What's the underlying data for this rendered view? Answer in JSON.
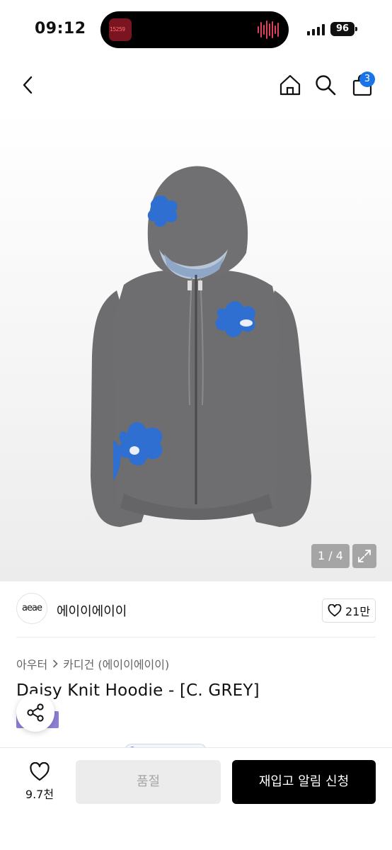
{
  "status": {
    "time": "09:12",
    "battery": "96",
    "island_thumb_text": "15259"
  },
  "nav": {
    "cart_count": "3"
  },
  "gallery": {
    "pager": "1 / 4"
  },
  "brand": {
    "logo_text": "aeae",
    "name": "에이이에이이",
    "likes": "21만"
  },
  "breadcrumb": {
    "category": "아우터",
    "subcategory": "카디건 (에이이에이이)"
  },
  "product": {
    "title": "Daisy Knit Hoodie - [C. GREY]"
  },
  "bottom": {
    "wish_count": "9.7천",
    "soldout_label": "품절",
    "restock_label": "재입고 알림 신청"
  },
  "colors": {
    "accent_blue": "#1b73e8",
    "hoodie_grey": "#6d6d6f",
    "flower_blue": "#2f6fd1",
    "chip_purple": "#8e80d6"
  }
}
